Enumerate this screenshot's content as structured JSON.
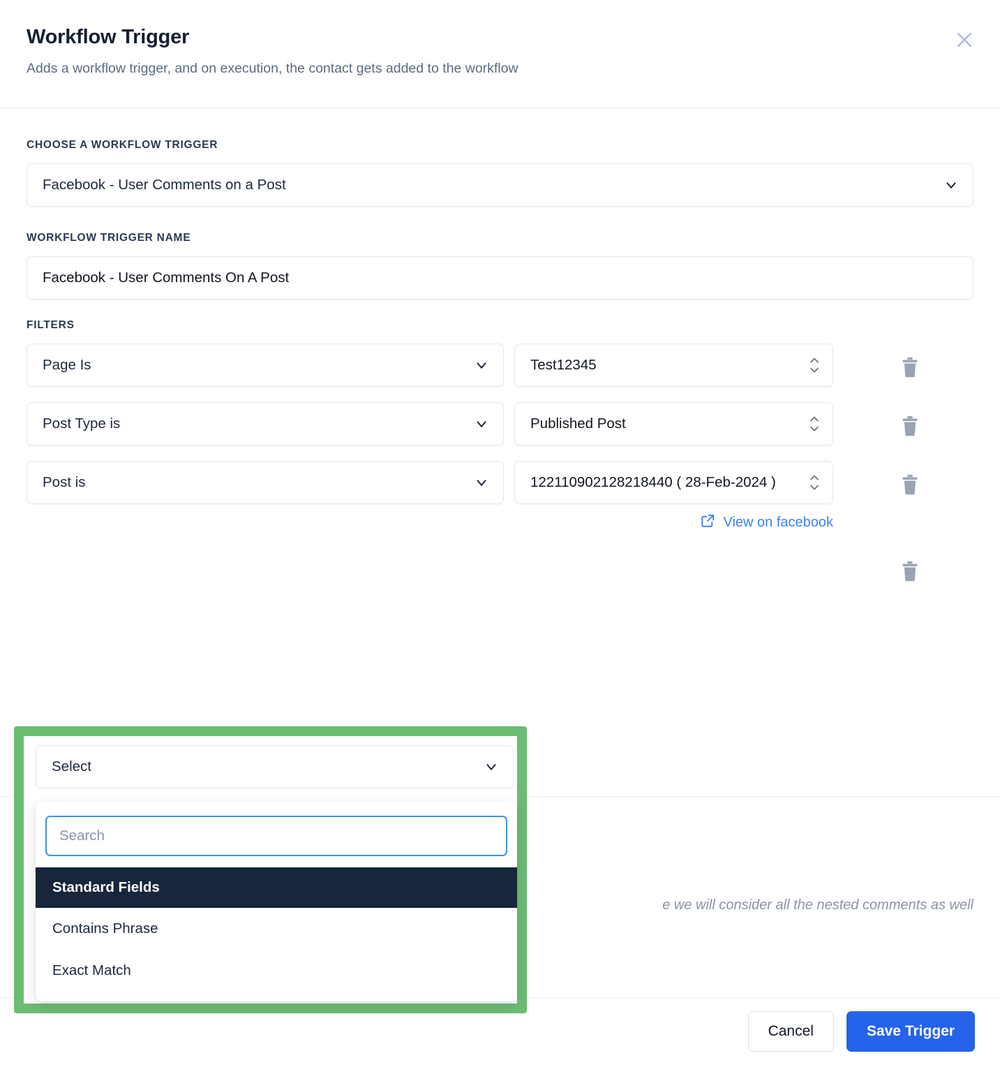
{
  "header": {
    "title": "Workflow Trigger",
    "subtitle": "Adds a workflow trigger, and on execution, the contact gets added to the workflow",
    "close_icon": "close-icon"
  },
  "trigger_section": {
    "label": "CHOOSE A WORKFLOW TRIGGER",
    "selected": "Facebook - User Comments on a Post"
  },
  "name_section": {
    "label": "WORKFLOW TRIGGER NAME",
    "value": "Facebook - User Comments On A Post"
  },
  "filters_section": {
    "label": "FILTERS",
    "rows": [
      {
        "condition": "Page Is",
        "value": "Test12345"
      },
      {
        "condition": "Post Type is",
        "value": "Published Post"
      },
      {
        "condition": "Post is",
        "value": "122110902128218440 ( 28-Feb-2024 )"
      }
    ],
    "view_link": "View on facebook"
  },
  "open_filter": {
    "select_placeholder": "Select",
    "search_placeholder": "Search",
    "group_header": "Standard Fields",
    "options": [
      "Contains Phrase",
      "Exact Match"
    ]
  },
  "note": "e we will consider all the nested comments as well",
  "footer": {
    "cancel": "Cancel",
    "save": "Save Trigger"
  },
  "colors": {
    "accent_blue": "#2563eb",
    "link_blue": "#3b82f6",
    "highlight_green": "#6bbd72",
    "group_header_bg": "#16263b",
    "focus_border": "#3b95e0"
  }
}
